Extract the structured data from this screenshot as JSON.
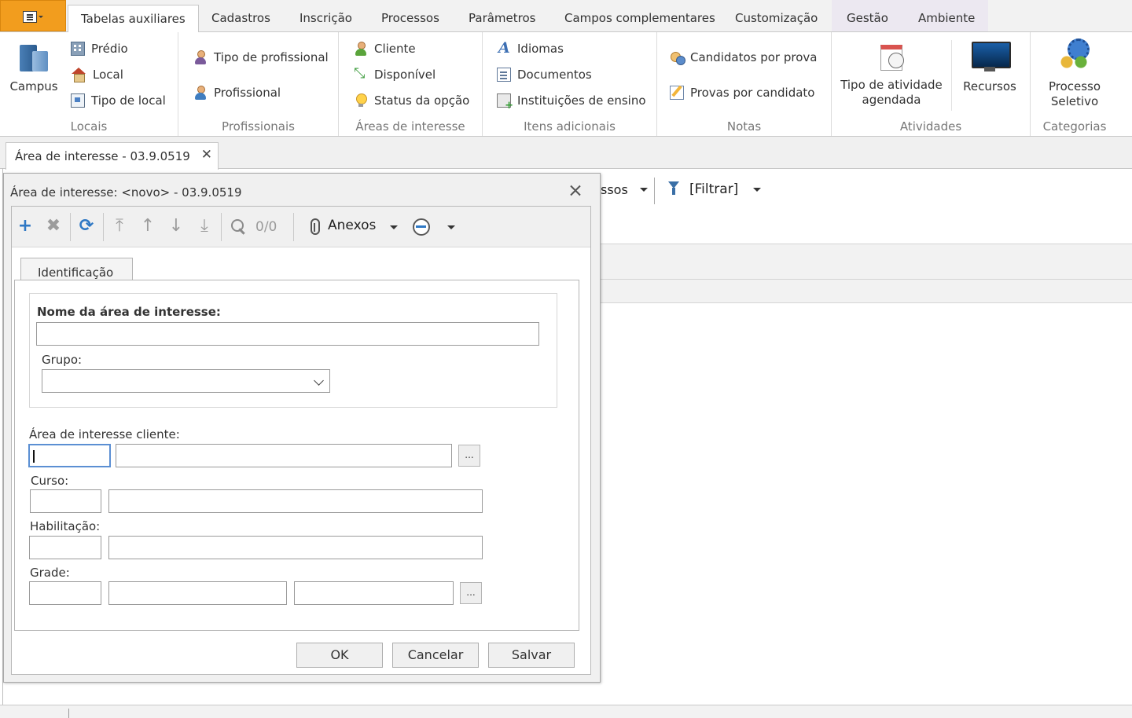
{
  "ribbon": {
    "tabs": [
      "Tabelas auxiliares",
      "Cadastros",
      "Inscrição",
      "Processos",
      "Parâmetros",
      "Campos complementares",
      "Customização",
      "Gestão",
      "Ambiente"
    ],
    "active_tab": "Tabelas auxiliares",
    "groups": {
      "locais": {
        "label": "Locais",
        "campus": "Campus",
        "predio": "Prédio",
        "local": "Local",
        "tipo_local": "Tipo de local"
      },
      "profissionais": {
        "label": "Profissionais",
        "tipo_profissional": "Tipo de profissional",
        "profissional": "Profissional"
      },
      "areas": {
        "label": "Áreas de interesse",
        "cliente": "Cliente",
        "disponivel": "Disponível",
        "status_opcao": "Status da opção"
      },
      "itens": {
        "label": "Itens adicionais",
        "idiomas": "Idiomas",
        "documentos": "Documentos",
        "instituicoes": "Instituições de ensino"
      },
      "notas": {
        "label": "Notas",
        "candidatos_prova": "Candidatos por prova",
        "provas_candidato": "Provas por candidato"
      },
      "atividades": {
        "label": "Atividades",
        "tipo_atividade": "Tipo de atividade agendada",
        "recursos": "Recursos"
      },
      "categorias": {
        "label": "Categorias",
        "processo_seletivo": "Processo Seletivo"
      }
    }
  },
  "doc_tab": {
    "label": "Área de interesse - 03.9.0519",
    "close_icon": "close-icon"
  },
  "background": {
    "processos_fragment": "ssos",
    "filter_label": "[Filtrar]"
  },
  "dialog": {
    "title": "Área de interesse: <novo> - 03.9.0519",
    "toolbar": {
      "count": "0/0",
      "anexos": "Anexos",
      "icons": [
        "add-icon",
        "delete-icon",
        "refresh-icon",
        "first-icon",
        "previous-icon",
        "next-icon",
        "last-icon",
        "search-icon",
        "attachment-icon",
        "database-icon"
      ]
    },
    "tab_label": "Identificação",
    "fields": {
      "nome_label": "Nome da área de interesse:",
      "nome_value": "",
      "grupo_label": "Grupo:",
      "grupo_value": "",
      "area_cliente_label": "Área de interesse cliente:",
      "curso_label": "Curso:",
      "habilitacao_label": "Habilitação:",
      "grade_label": "Grade:"
    },
    "buttons": {
      "ok": "OK",
      "cancel": "Cancelar",
      "save": "Salvar",
      "ellipsis": "..."
    }
  },
  "colors": {
    "app_button": "#f29d1e",
    "accent_blue": "#2f78c4",
    "context_tab_bg": "#ece8f1"
  }
}
